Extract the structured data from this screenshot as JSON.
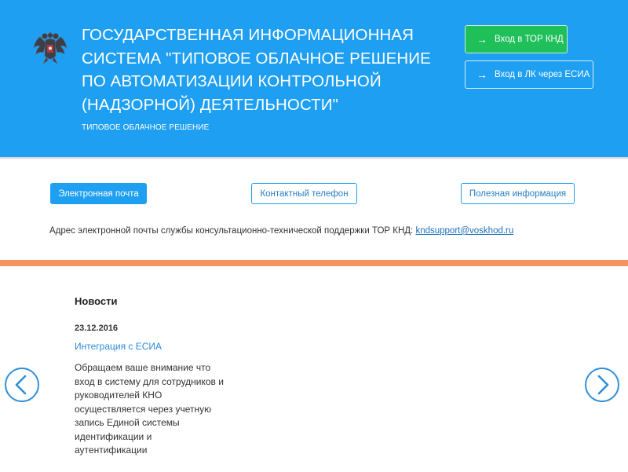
{
  "header": {
    "title": "ГОСУДАРСТВЕННАЯ ИНФОРМАЦИОННАЯ СИСТЕМА \"ТИПОВОЕ ОБЛАЧНОЕ РЕШЕНИЕ ПО АВТОМАТИЗАЦИИ КОНТРОЛЬНОЙ (НАДЗОРНОЙ) ДЕЯТЕЛЬНОСТИ\"",
    "subtitle": "ТИПОВОЕ ОБЛАЧНОЕ РЕШЕНИЕ",
    "emblem_icon": "russian-coat-of-arms-icon",
    "buttons": {
      "tor_arrow": "→",
      "tor_label": "Вход в ТОР КНД",
      "esia_arrow": "→",
      "esia_label": "Вход в ЛК через ЕСИА"
    }
  },
  "tabs": {
    "email": "Электронная почта",
    "phone": "Контактный телефон",
    "info": "Полезная информация"
  },
  "contact": {
    "text": "Адрес электронной почты службы консультационно-технической поддержки ТОР КНД: ",
    "email": "kndsupport@voskhod.ru"
  },
  "news": {
    "heading": "Новости",
    "date": "23.12.2016",
    "link": "Интеграция с ЕСИА",
    "text": "Обращаем ваше внимание что вход в систему для сотрудников и руководителей КНО осуществляется через учетную запись Единой системы идентификации и аутентификации"
  },
  "colors": {
    "header_bg": "#1e9ff2",
    "tor_button": "#1fbf5a",
    "orange_bar": "#f59462",
    "link": "#2a8ad8"
  },
  "icons": {
    "prev": "chevron-left-icon",
    "next": "chevron-right-icon"
  }
}
